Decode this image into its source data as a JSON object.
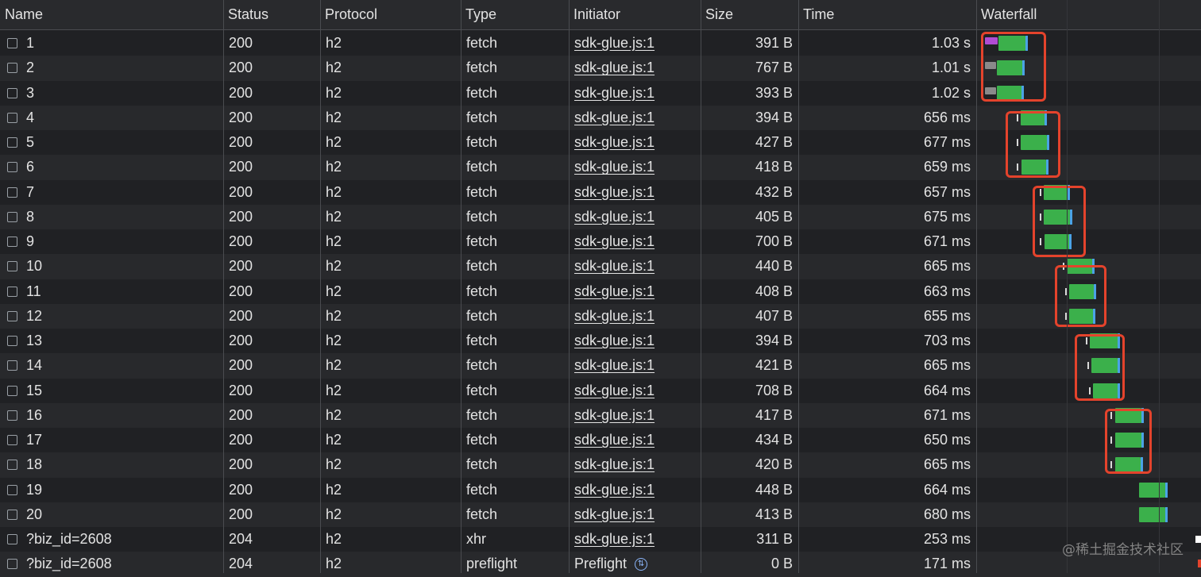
{
  "columns": [
    {
      "key": "name",
      "label": "Name"
    },
    {
      "key": "status",
      "label": "Status"
    },
    {
      "key": "protocol",
      "label": "Protocol"
    },
    {
      "key": "type",
      "label": "Type"
    },
    {
      "key": "initiator",
      "label": "Initiator"
    },
    {
      "key": "size",
      "label": "Size"
    },
    {
      "key": "time",
      "label": "Time"
    },
    {
      "key": "waterfall",
      "label": "Waterfall"
    }
  ],
  "rows": [
    {
      "name": "1",
      "status": "200",
      "protocol": "h2",
      "type": "fetch",
      "initiator": "sdk-glue.js:1",
      "size": "391 B",
      "time": "1.03 s"
    },
    {
      "name": "2",
      "status": "200",
      "protocol": "h2",
      "type": "fetch",
      "initiator": "sdk-glue.js:1",
      "size": "767 B",
      "time": "1.01 s"
    },
    {
      "name": "3",
      "status": "200",
      "protocol": "h2",
      "type": "fetch",
      "initiator": "sdk-glue.js:1",
      "size": "393 B",
      "time": "1.02 s"
    },
    {
      "name": "4",
      "status": "200",
      "protocol": "h2",
      "type": "fetch",
      "initiator": "sdk-glue.js:1",
      "size": "394 B",
      "time": "656 ms"
    },
    {
      "name": "5",
      "status": "200",
      "protocol": "h2",
      "type": "fetch",
      "initiator": "sdk-glue.js:1",
      "size": "427 B",
      "time": "677 ms"
    },
    {
      "name": "6",
      "status": "200",
      "protocol": "h2",
      "type": "fetch",
      "initiator": "sdk-glue.js:1",
      "size": "418 B",
      "time": "659 ms"
    },
    {
      "name": "7",
      "status": "200",
      "protocol": "h2",
      "type": "fetch",
      "initiator": "sdk-glue.js:1",
      "size": "432 B",
      "time": "657 ms"
    },
    {
      "name": "8",
      "status": "200",
      "protocol": "h2",
      "type": "fetch",
      "initiator": "sdk-glue.js:1",
      "size": "405 B",
      "time": "675 ms"
    },
    {
      "name": "9",
      "status": "200",
      "protocol": "h2",
      "type": "fetch",
      "initiator": "sdk-glue.js:1",
      "size": "700 B",
      "time": "671 ms"
    },
    {
      "name": "10",
      "status": "200",
      "protocol": "h2",
      "type": "fetch",
      "initiator": "sdk-glue.js:1",
      "size": "440 B",
      "time": "665 ms"
    },
    {
      "name": "11",
      "status": "200",
      "protocol": "h2",
      "type": "fetch",
      "initiator": "sdk-glue.js:1",
      "size": "408 B",
      "time": "663 ms"
    },
    {
      "name": "12",
      "status": "200",
      "protocol": "h2",
      "type": "fetch",
      "initiator": "sdk-glue.js:1",
      "size": "407 B",
      "time": "655 ms"
    },
    {
      "name": "13",
      "status": "200",
      "protocol": "h2",
      "type": "fetch",
      "initiator": "sdk-glue.js:1",
      "size": "394 B",
      "time": "703 ms"
    },
    {
      "name": "14",
      "status": "200",
      "protocol": "h2",
      "type": "fetch",
      "initiator": "sdk-glue.js:1",
      "size": "421 B",
      "time": "665 ms"
    },
    {
      "name": "15",
      "status": "200",
      "protocol": "h2",
      "type": "fetch",
      "initiator": "sdk-glue.js:1",
      "size": "708 B",
      "time": "664 ms"
    },
    {
      "name": "16",
      "status": "200",
      "protocol": "h2",
      "type": "fetch",
      "initiator": "sdk-glue.js:1",
      "size": "417 B",
      "time": "671 ms"
    },
    {
      "name": "17",
      "status": "200",
      "protocol": "h2",
      "type": "fetch",
      "initiator": "sdk-glue.js:1",
      "size": "434 B",
      "time": "650 ms"
    },
    {
      "name": "18",
      "status": "200",
      "protocol": "h2",
      "type": "fetch",
      "initiator": "sdk-glue.js:1",
      "size": "420 B",
      "time": "665 ms"
    },
    {
      "name": "19",
      "status": "200",
      "protocol": "h2",
      "type": "fetch",
      "initiator": "sdk-glue.js:1",
      "size": "448 B",
      "time": "664 ms"
    },
    {
      "name": "20",
      "status": "200",
      "protocol": "h2",
      "type": "fetch",
      "initiator": "sdk-glue.js:1",
      "size": "413 B",
      "time": "680 ms"
    },
    {
      "name": "?biz_id=2608",
      "status": "204",
      "protocol": "h2",
      "type": "xhr",
      "initiator": "sdk-glue.js:1",
      "size": "311 B",
      "time": "253 ms"
    },
    {
      "name": "?biz_id=2608",
      "status": "204",
      "protocol": "h2",
      "type": "preflight",
      "initiator": "Preflight",
      "initiator_icon": "preflight-icon",
      "size": "0 B",
      "time": "171 ms"
    }
  ],
  "waterfall_colors": {
    "stalled_purple": "#b04cd3",
    "stalled_gray": "#8a8a8a",
    "download_green": "#3bb04b",
    "content_blue": "#4aa3e6",
    "annotation_red": "#e4432c"
  },
  "watermark": "@稀土掘金技术社区"
}
